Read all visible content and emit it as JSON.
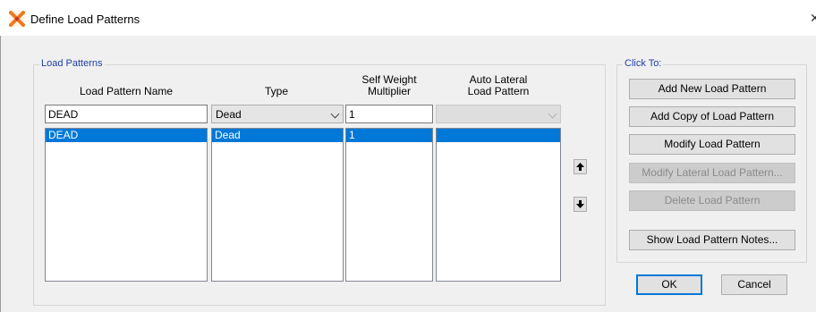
{
  "window": {
    "title": "Define Load Patterns",
    "close_glyph": "✕",
    "icon": "sap-app-icon"
  },
  "load_patterns": {
    "group_label": "Load Patterns",
    "columns": {
      "name": "Load Pattern Name",
      "type": "Type",
      "self_weight": [
        "Self Weight",
        "Multiplier"
      ],
      "auto_lateral": [
        "Auto Lateral",
        "Load Pattern"
      ]
    },
    "editor": {
      "name_value": "DEAD",
      "type_value": "Dead",
      "self_weight_value": "1",
      "auto_lateral_value": ""
    },
    "rows": [
      {
        "name": "DEAD",
        "type": "Dead",
        "self_weight": "1",
        "auto_lateral": ""
      }
    ],
    "move_up_icon": "arrow-up-icon",
    "move_down_icon": "arrow-down-icon"
  },
  "click_to": {
    "group_label": "Click To:",
    "buttons": [
      {
        "label": "Add New Load Pattern",
        "enabled": true
      },
      {
        "label": "Add Copy of Load Pattern",
        "enabled": true
      },
      {
        "label": "Modify Load Pattern",
        "enabled": true
      },
      {
        "label": "Modify Lateral Load Pattern...",
        "enabled": false
      },
      {
        "label": "Delete Load Pattern",
        "enabled": false
      },
      {
        "label": "Show Load Pattern Notes...",
        "enabled": true
      }
    ]
  },
  "footer": {
    "ok_label": "OK",
    "cancel_label": "Cancel"
  },
  "colors": {
    "selection": "#0078d7",
    "group_label": "#1f3fa6",
    "app_icon_orange": "#f07820"
  }
}
